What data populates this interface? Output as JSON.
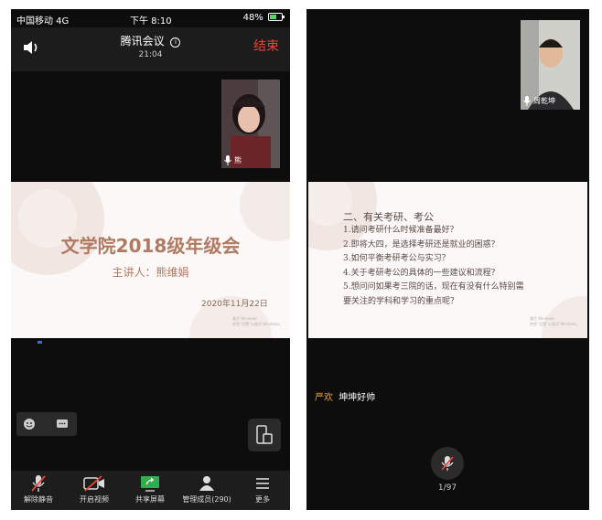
{
  "left_phone": {
    "status": {
      "carrier": "中国移动 4G",
      "time": "下午 8:10",
      "battery": "48%"
    },
    "header": {
      "title": "腾讯会议",
      "duration": "21:04",
      "end_label": "结束"
    },
    "video_tile": {
      "name": "熊"
    },
    "slide": {
      "title": "文学院2018级年级会",
      "speaker": "主讲人：熊维娟",
      "date": "2020年11月22日",
      "watermark_line1": "激活 Windows",
      "watermark_line2": "转到“设置”以激活 Windows。"
    },
    "toolbar": [
      {
        "label": "解除静音",
        "icon": "mic-muted-icon"
      },
      {
        "label": "开启视频",
        "icon": "video-off-icon"
      },
      {
        "label": "共享屏幕",
        "icon": "share-screen-icon"
      },
      {
        "label": "管理成员(290)",
        "icon": "members-icon"
      },
      {
        "label": "更多",
        "icon": "more-icon"
      }
    ]
  },
  "right_phone": {
    "video_tile": {
      "name": "周乾坤"
    },
    "slide": {
      "heading": "二、有关考研、考公",
      "items": [
        "1.请问考研什么时候准备最好？",
        "2.即将大四，是选择考研还是就业的困惑？",
        "3.如何平衡考研考公与实习？",
        "4.关于考研考公的具体的一些建议和流程？",
        "5.想问问如果考三院的话，现在有没有什么特别需",
        "要关注的学科和学习的重点呢？"
      ],
      "watermark_line1": "激活 Windows",
      "watermark_line2": "转到“设置”以激活 Windows。"
    },
    "chat": {
      "sender": "严欢",
      "message": "坤坤好帅"
    },
    "page_counter": "1/97"
  },
  "colors": {
    "end_red": "#e8453c",
    "slide_title": "#b07a62",
    "chat_sender": "#e8a33a",
    "share_green": "#2fae4e"
  }
}
